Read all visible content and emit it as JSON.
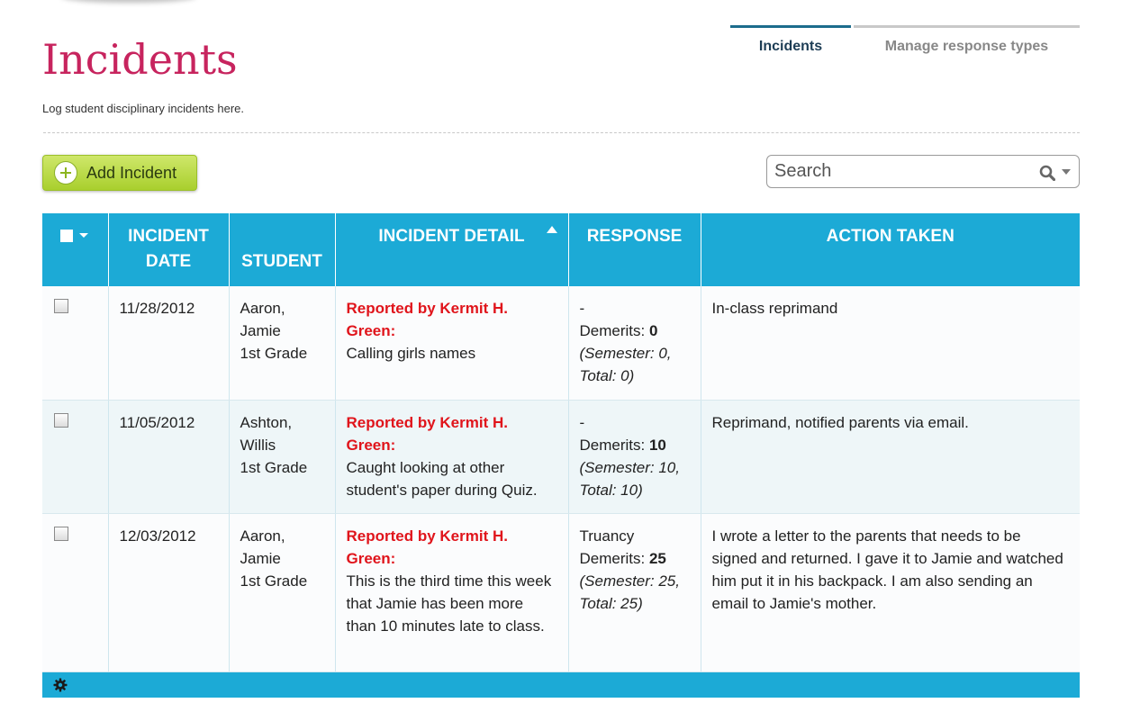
{
  "page": {
    "title": "Incidents",
    "subtitle": "Log student disciplinary incidents here."
  },
  "tabs": [
    {
      "label": "Incidents",
      "active": true
    },
    {
      "label": "Manage response types",
      "active": false
    }
  ],
  "toolbar": {
    "add_label": "Add Incident",
    "search_placeholder": "Search"
  },
  "table": {
    "headers": {
      "date_line1": "INCIDENT",
      "date_line2": "DATE",
      "student": "STUDENT",
      "detail": "INCIDENT DETAIL",
      "response": "RESPONSE",
      "action": "ACTION TAKEN"
    },
    "rows": [
      {
        "date": "11/28/2012",
        "student_line1": "Aaron,",
        "student_line2": "Jamie",
        "grade": "1st Grade",
        "reporter": "Reported by Kermit H. Green:",
        "detail": "Calling girls names",
        "response_type": "-",
        "demerits_label": "Demerits: ",
        "demerits": "0",
        "semester": "(Semester: 0,",
        "total": "Total: 0)",
        "action": "In-class reprimand"
      },
      {
        "date": "11/05/2012",
        "student_line1": "Ashton,",
        "student_line2": "Willis",
        "grade": "1st Grade",
        "reporter": "Reported by Kermit H. Green:",
        "detail": "Caught looking at other student's paper during Quiz.",
        "response_type": "-",
        "demerits_label": "Demerits: ",
        "demerits": "10",
        "semester": "(Semester: 10,",
        "total": "Total: 10)",
        "action": "Reprimand, notified parents via email."
      },
      {
        "date": "12/03/2012",
        "student_line1": "Aaron,",
        "student_line2": "Jamie",
        "grade": "1st Grade",
        "reporter": "Reported by Kermit H. Green:",
        "detail": "This is the third time this week that Jamie has been more than 10 minutes late to class.",
        "response_type": "Truancy",
        "demerits_label": "Demerits: ",
        "demerits": "25",
        "semester": "(Semester: 25,",
        "total": "Total: 25)",
        "action": "I wrote a letter to the parents that needs to be signed and returned. I gave it to Jamie and watched him put it in his backpack. I am also sending an email to Jamie's mother."
      }
    ]
  },
  "icons": {
    "add": "plus-circle-icon",
    "search": "search-icon",
    "settings": "gear-icon",
    "sort": "sort-ascending-icon"
  },
  "colors": {
    "title": "#c7245e",
    "header_bg": "#1caad6",
    "reporter": "#e0141b",
    "button": "#b8d940",
    "active_tab": "#1c6c8c"
  }
}
